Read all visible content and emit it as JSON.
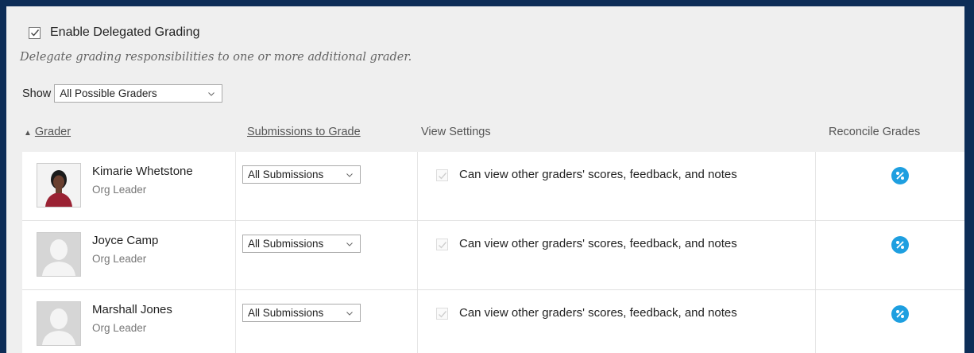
{
  "settings": {
    "enable_label": "Enable Delegated Grading",
    "enabled": true,
    "description": "Delegate grading responsibilities to one or more additional grader."
  },
  "filter": {
    "show_label": "Show",
    "selected": "All Possible Graders"
  },
  "columns": {
    "grader": "Grader",
    "submissions": "Submissions to Grade",
    "view_settings": "View Settings",
    "reconcile": "Reconcile Grades"
  },
  "graders": [
    {
      "name": "Kimarie Whetstone",
      "role": "Org Leader",
      "submissions": "All Submissions",
      "view_label": "Can view other graders' scores, feedback, and notes",
      "photo": true
    },
    {
      "name": "Joyce Camp",
      "role": "Org Leader",
      "submissions": "All Submissions",
      "view_label": "Can view other graders' scores, feedback, and notes",
      "photo": false
    },
    {
      "name": "Marshall Jones",
      "role": "Org Leader",
      "submissions": "All Submissions",
      "view_label": "Can view other graders' scores, feedback, and notes",
      "photo": false
    }
  ],
  "icons": {
    "reconcile": "reconcile-grades-icon",
    "sort": "sort-ascending-icon"
  },
  "colors": {
    "accent": "#1e9fe0",
    "frame": "#0d2d57",
    "panel": "#efefef"
  }
}
